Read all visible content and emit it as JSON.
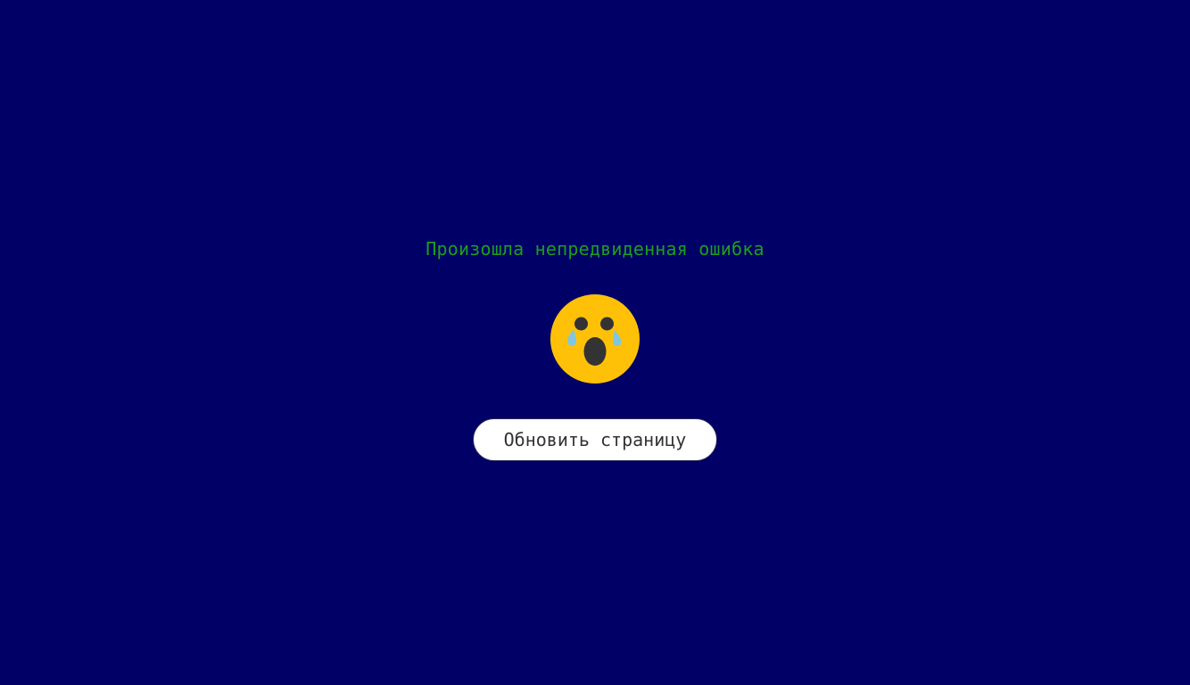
{
  "error": {
    "message": "Произошла непредвиденная ошибка",
    "message_color": "#1e9e1e",
    "icon": "crying-face-icon"
  },
  "actions": {
    "reload_label": "Обновить страницу"
  },
  "colors": {
    "background": "#000066",
    "emoji_face": "#FFC107",
    "emoji_features": "#333333",
    "emoji_tears": "#7FC7E0",
    "button_bg": "#FFFFFF"
  }
}
